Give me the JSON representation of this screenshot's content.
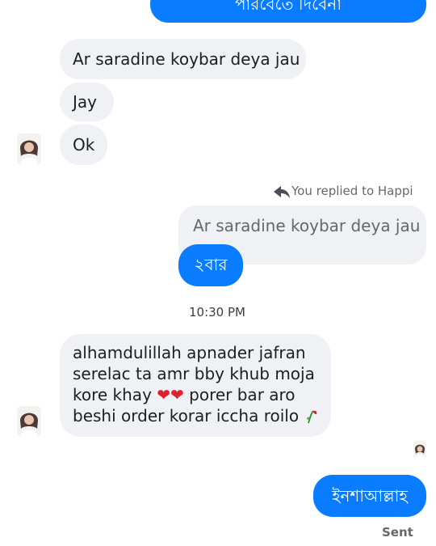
{
  "conversation": {
    "top_outgoing_partial": "পারবেতে দিবেনা",
    "incoming_group_1": [
      "Ar saradine koybar deya jau",
      "Jay",
      "Ok"
    ],
    "reply_meta": "You replied to Happi",
    "quoted_message": "Ar saradine koybar deya jau",
    "reply_message": "২বার",
    "timestamp": "10:30 PM",
    "incoming_long": {
      "line1": "alhamdulillah apnader jafran",
      "line2": "serelac ta amr bby khub moja",
      "line3_prefix": "kore khay",
      "line3_suffix": " porer bar aro",
      "line4": "beshi order korar iccha roilo"
    },
    "last_outgoing": "ইনশাআল্লাহ",
    "status": "Sent"
  },
  "icons": {
    "avatar": "contact-avatar-icon",
    "reply": "reply-arrow-icon",
    "hearts": "red-heart-icon",
    "flower": "wilted-flower-icon"
  },
  "colors": {
    "outgoing": "#0a7cff",
    "incoming": "#f0f1f4",
    "meta": "#65676b",
    "heart": "#e0202f"
  }
}
